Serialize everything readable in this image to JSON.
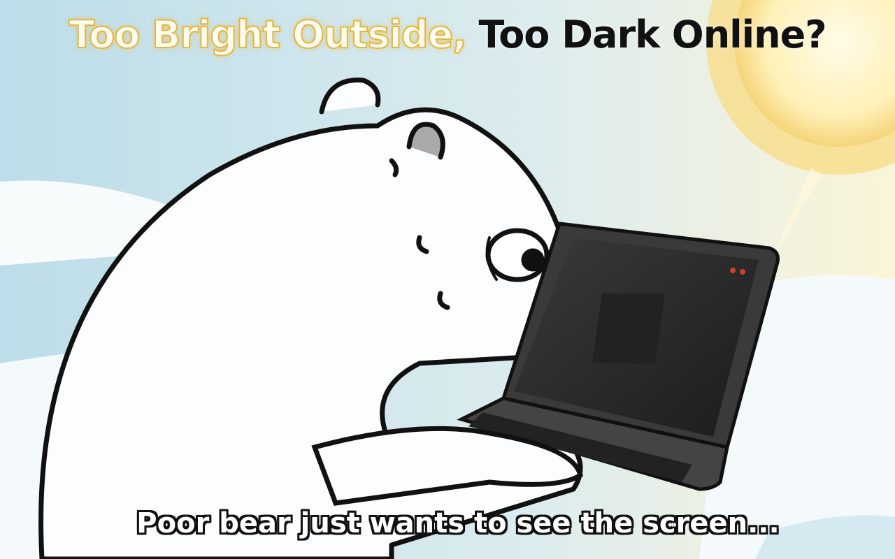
{
  "title": {
    "part1": "Too Bright Outside,",
    "part2": "Too Dark Online?"
  },
  "caption": "Poor bear just wants to see the screen...",
  "colors": {
    "sky": "#c3e1ec",
    "sun": "#fbe6a0",
    "title_glow": "#e6b640",
    "laptop": "#2b2b2b",
    "bear_outline": "#111111"
  }
}
